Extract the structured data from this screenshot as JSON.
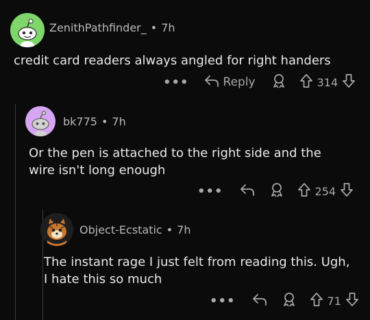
{
  "comments": [
    {
      "username": "ZenithPathfinder_",
      "time": "7h",
      "text": "credit card readers always angled for right handers",
      "more": "•••",
      "reply_label": "Reply",
      "score": "314",
      "avatar_color": "#7fd66a"
    },
    {
      "username": "bk775",
      "time": "7h",
      "text": "Or the pen is attached to the right side and the wire isn't long enough",
      "more": "•••",
      "score": "254",
      "avatar_color": "#d7a6f2"
    },
    {
      "username": "Object-Ecstatic",
      "time": "7h",
      "text": "The instant rage I just felt from reading this. Ugh, I hate this so much",
      "more": "•••",
      "score": "71",
      "avatar_color": "#2a2a2a"
    }
  ],
  "separator": "•",
  "colors": {
    "background": "#0b0b0b",
    "text": "#e9e9e9",
    "muted": "#a9a9a9",
    "thread_line": "#3a3a3a"
  }
}
